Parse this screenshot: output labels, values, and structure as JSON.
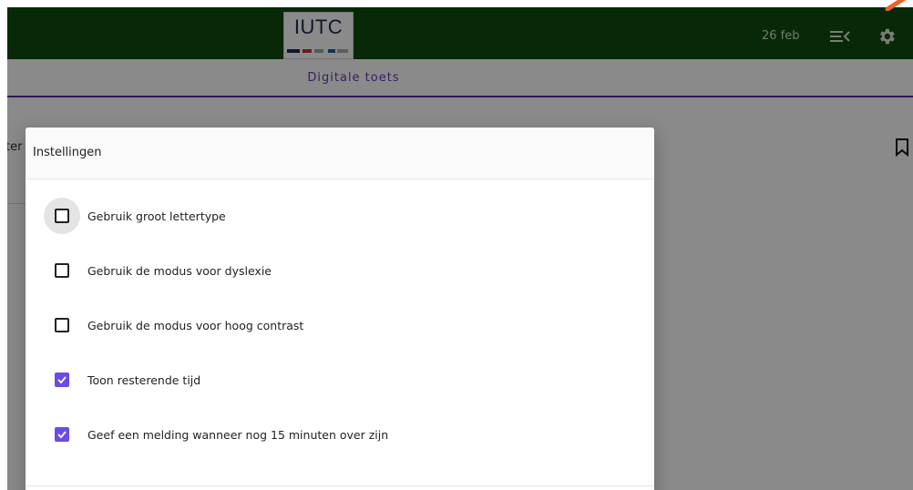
{
  "app": {
    "logo_text": "IUTC",
    "date": "26 feb",
    "subtitle": "Digitale toets",
    "partial_text": "ter"
  },
  "dialog": {
    "title": "Instellingen",
    "options": [
      {
        "label": "Gebruik groot lettertype",
        "checked": false,
        "focused": true
      },
      {
        "label": "Gebruik de modus voor dyslexie",
        "checked": false,
        "focused": false
      },
      {
        "label": "Gebruik de modus voor hoog contrast",
        "checked": false,
        "focused": false
      },
      {
        "label": "Toon resterende tijd",
        "checked": true,
        "focused": false
      },
      {
        "label": "Geef een melding wanneer nog 15 minuten over zijn",
        "checked": true,
        "focused": false
      }
    ]
  },
  "icons": {
    "menu": "menu-collapse-icon",
    "settings": "gear-icon",
    "bookmark": "bookmark-icon"
  },
  "colors": {
    "topbar": "#0e4d0d",
    "accent": "#6c4be6",
    "subtitle": "#6a3ab8"
  }
}
